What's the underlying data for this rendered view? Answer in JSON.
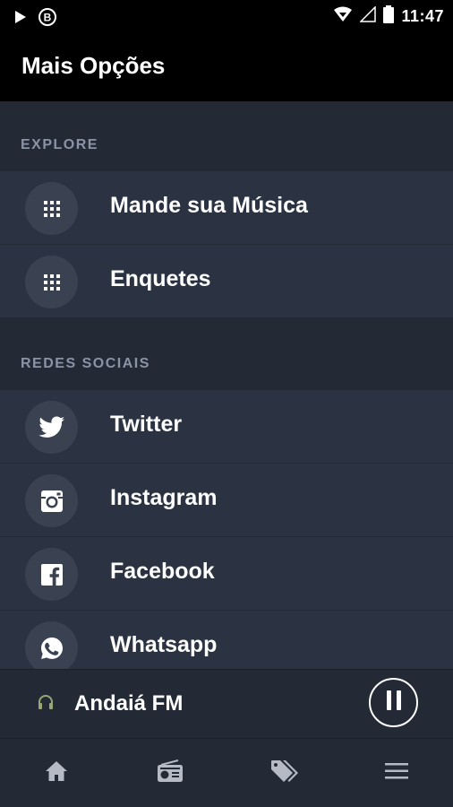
{
  "status_bar": {
    "time": "11:47",
    "icons": [
      "play-icon",
      "b-badge-icon",
      "wifi-icon",
      "signal-icon",
      "battery-icon"
    ]
  },
  "app_bar": {
    "title": "Mais Opções"
  },
  "sections": [
    {
      "header": "EXPLORE",
      "items": [
        {
          "label": "Mande sua Música",
          "icon": "grid-icon"
        },
        {
          "label": "Enquetes",
          "icon": "grid-icon"
        }
      ]
    },
    {
      "header": "REDES SOCIAIS",
      "items": [
        {
          "label": "Twitter",
          "icon": "twitter-icon"
        },
        {
          "label": "Instagram",
          "icon": "instagram-icon"
        },
        {
          "label": "Facebook",
          "icon": "facebook-icon"
        },
        {
          "label": "Whatsapp",
          "icon": "whatsapp-icon"
        }
      ]
    }
  ],
  "player": {
    "station": "Andaiá FM",
    "state": "playing"
  },
  "bottom_nav": [
    "home-icon",
    "radio-icon",
    "tags-icon",
    "menu-icon"
  ],
  "colors": {
    "background": "#232a36",
    "row": "#2b3342",
    "icon_circle": "#3a4252",
    "header_text": "#8b94a6",
    "bar": "#000000",
    "nav_icon": "#b5bac4"
  }
}
